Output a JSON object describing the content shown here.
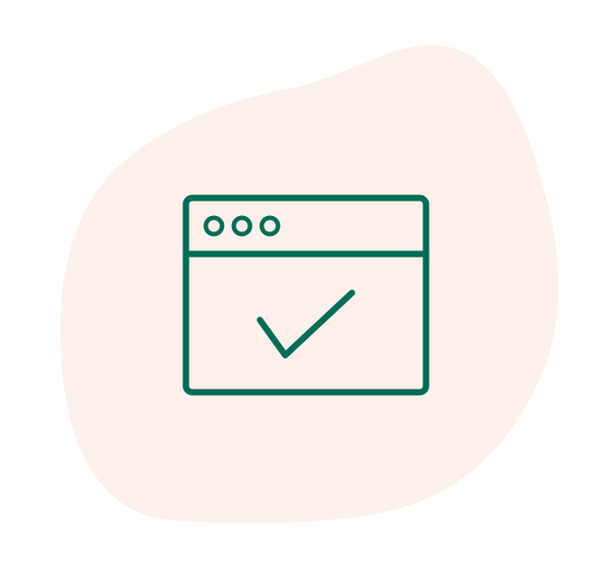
{
  "illustration": {
    "subject": "browser-window-check-icon",
    "colors": {
      "background": "#ffffff",
      "blob": "#fcf1ea",
      "stroke": "#046b56"
    },
    "icons": {
      "blob": "background-blob",
      "window": "browser-window-icon",
      "dots": "window-dots-icon",
      "check": "checkmark-icon"
    }
  }
}
